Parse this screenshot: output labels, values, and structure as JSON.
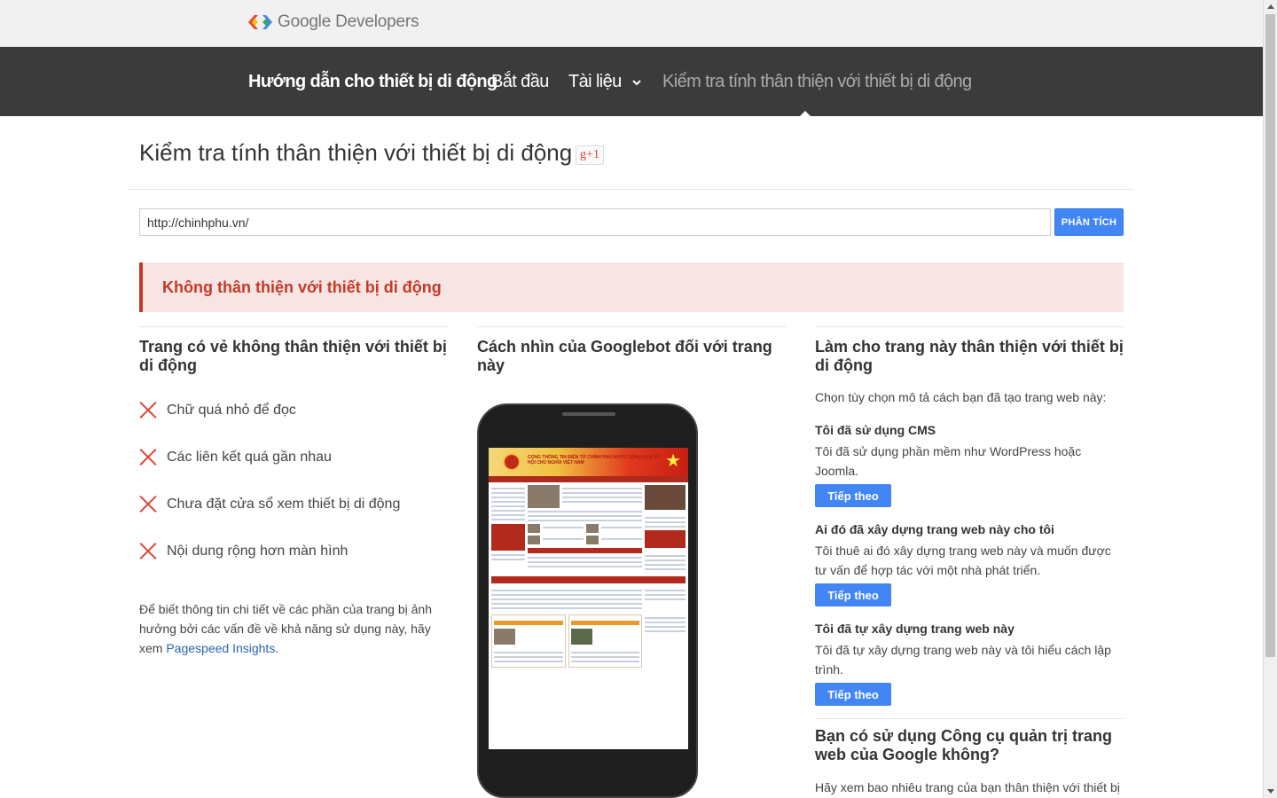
{
  "header": {
    "logo_text": "Google Developers"
  },
  "nav": {
    "brand": "Hướng dẫn cho thiết bị di động",
    "start": "Bắt đầu",
    "docs": "Tài liệu",
    "current": "Kiểm tra tính thân thiện với thiết bị di động"
  },
  "page": {
    "title": "Kiểm tra tính thân thiện với thiết bị di động",
    "gplus_label": "g+1"
  },
  "search": {
    "value": "http://chinhphu.vn/",
    "button_label": "PHÂN TÍCH"
  },
  "result": {
    "banner": "Không thân thiện với thiết bị di động"
  },
  "col1": {
    "heading": "Trang có vẻ không thân thiện với thiết bị di động",
    "issues": [
      "Chữ quá nhỏ để đọc",
      "Các liên kết quá gần nhau",
      "Chưa đặt cửa sổ xem thiết bị di động",
      "Nội dung rộng hơn màn hình"
    ],
    "detail_prefix": "Để biết thông tin chi tiết về các phần của trang bị ảnh hưởng bởi các vấn đề về khả năng sử dụng này, hãy xem ",
    "detail_link": "Pagespeed Insights",
    "detail_suffix": "."
  },
  "col2": {
    "heading": "Cách nhìn của Googlebot đối với trang này",
    "screen_title": "CỔNG THÔNG TIN ĐIỆN TỬ CHÍNH PHỦ NƯỚC CỘNG HOÀ XÃ HỘI CHỦ NGHĨA VIỆT NAM"
  },
  "col3": {
    "heading": "Làm cho trang này thân thiện với thiết bị di động",
    "intro": "Chọn tùy chọn mô tả cách bạn đã tạo trang web này:",
    "options": [
      {
        "title": "Tôi đã sử dụng CMS",
        "desc": "Tôi đã sử dụng phần mềm như WordPress hoặc Joomla.",
        "button": "Tiếp theo"
      },
      {
        "title": "Ai đó đã xây dựng trang web này cho tôi",
        "desc": "Tôi thuê ai đó xây dựng trang web này và muốn được tư vấn để hợp tác với một nhà phát triển.",
        "button": "Tiếp theo"
      },
      {
        "title": "Tôi đã tự xây dựng trang web này",
        "desc": "Tôi đã tự xây dựng trang web này và tôi hiểu cách lập trình.",
        "button": "Tiếp theo"
      }
    ],
    "question": "Bạn có sử dụng Công cụ quản trị trang web của Google không?",
    "question_desc": "Hãy xem bao nhiêu trang của bạn thân thiện với thiết bị"
  },
  "colors": {
    "nav_bg": "#3b3b3b",
    "accent": "#4285f4",
    "error": "#c53929",
    "banner_bg": "#f7e5e3"
  },
  "icons": [
    "google-developers-logo",
    "chevron-down-icon",
    "x-icon",
    "gplus-icon"
  ]
}
